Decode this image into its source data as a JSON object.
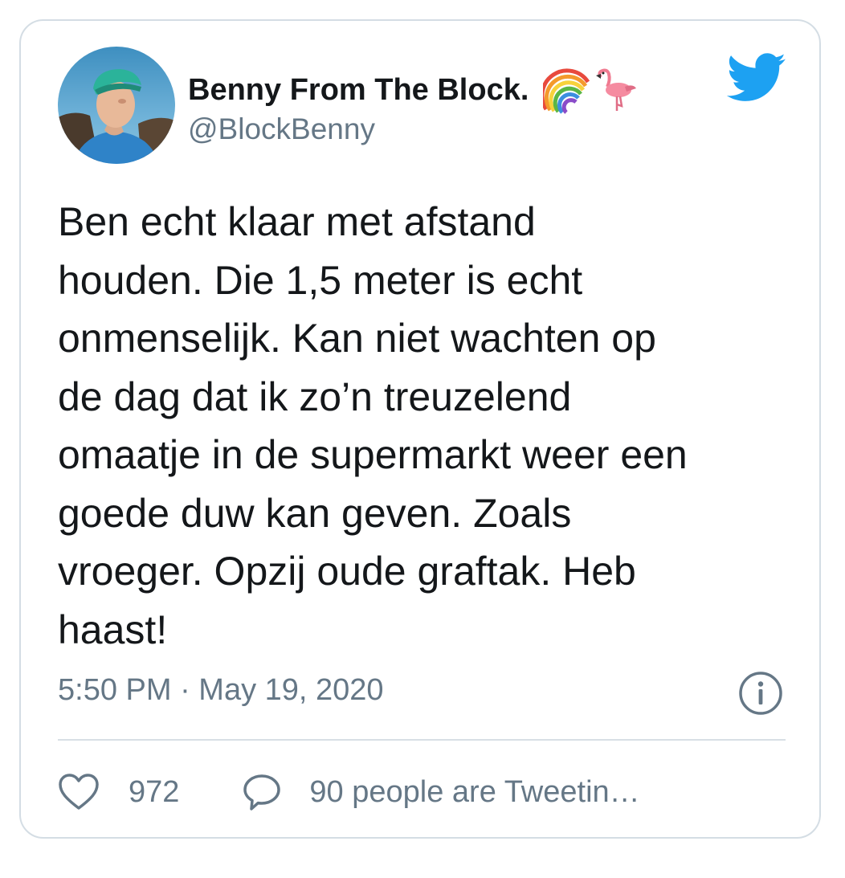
{
  "tweet": {
    "author": {
      "display_name": "Benny From The Block.",
      "handle": "@BlockBenny",
      "name_emojis": [
        "rainbow-emoji",
        "flamingo-emoji"
      ],
      "avatar": "profile-photo"
    },
    "platform_icon": "twitter-bird-icon",
    "text": "Ben echt klaar met afstand\nhouden. Die 1,5 meter is echt\nonmenselijk. Kan niet wachten op\nde dag dat ik zo’n treuzelend\nomaatje in de supermarkt weer een\ngoede duw kan geven. Zoals\nvroeger. Opzij oude graftak. Heb\nhaast!",
    "timestamp": "5:50 PM · May 19, 2020",
    "actions": {
      "like_count": "972",
      "reply_label": "90 people are Tweetin…"
    }
  },
  "colors": {
    "text_primary": "#14171a",
    "text_secondary": "#657786",
    "twitter_blue": "#1da1f2",
    "border": "#d4dde4"
  }
}
